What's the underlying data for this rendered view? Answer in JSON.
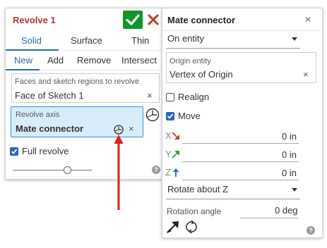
{
  "revolve": {
    "title": "Revolve 1",
    "tabs_type": [
      "Solid",
      "Surface",
      "Thin"
    ],
    "tabs_op": [
      "New",
      "Add",
      "Remove",
      "Intersect"
    ],
    "faces": {
      "label": "Faces and sketch regions to revolve",
      "value": "Face of Sketch 1",
      "clear": "×"
    },
    "axis": {
      "label": "Revolve axis",
      "value": "Mate connector",
      "clear": "×"
    },
    "full_revolve": {
      "label": "Full revolve",
      "checked": true
    },
    "help": "?"
  },
  "mate": {
    "title": "Mate connector",
    "close": "×",
    "placement": "On entity",
    "origin": {
      "label": "Origin entity",
      "value": "Vertex of Origin",
      "clear": "×"
    },
    "realign": {
      "label": "Realign",
      "checked": false
    },
    "move": {
      "label": "Move",
      "checked": true
    },
    "x": {
      "letter": "X",
      "value": "0 in"
    },
    "y": {
      "letter": "Y",
      "value": "0 in"
    },
    "z": {
      "letter": "Z",
      "value": "0 in"
    },
    "rotate": "Rotate about Z",
    "rotation": {
      "label": "Rotation angle",
      "value": "0 deg"
    },
    "help": "?"
  },
  "colors": {
    "title_red": "#b8312f",
    "accent_blue": "#2a66b9",
    "ok_green": "#11962e",
    "x_red": "#c0392b",
    "y_green": "#2e9c3a",
    "z_blue": "#2a66b9",
    "annotation_arrow": "#e41b1b"
  },
  "icons": [
    "check-icon",
    "close-icon",
    "clock-icon",
    "flip-arrow-icon",
    "rotate-icon",
    "help-icon"
  ]
}
